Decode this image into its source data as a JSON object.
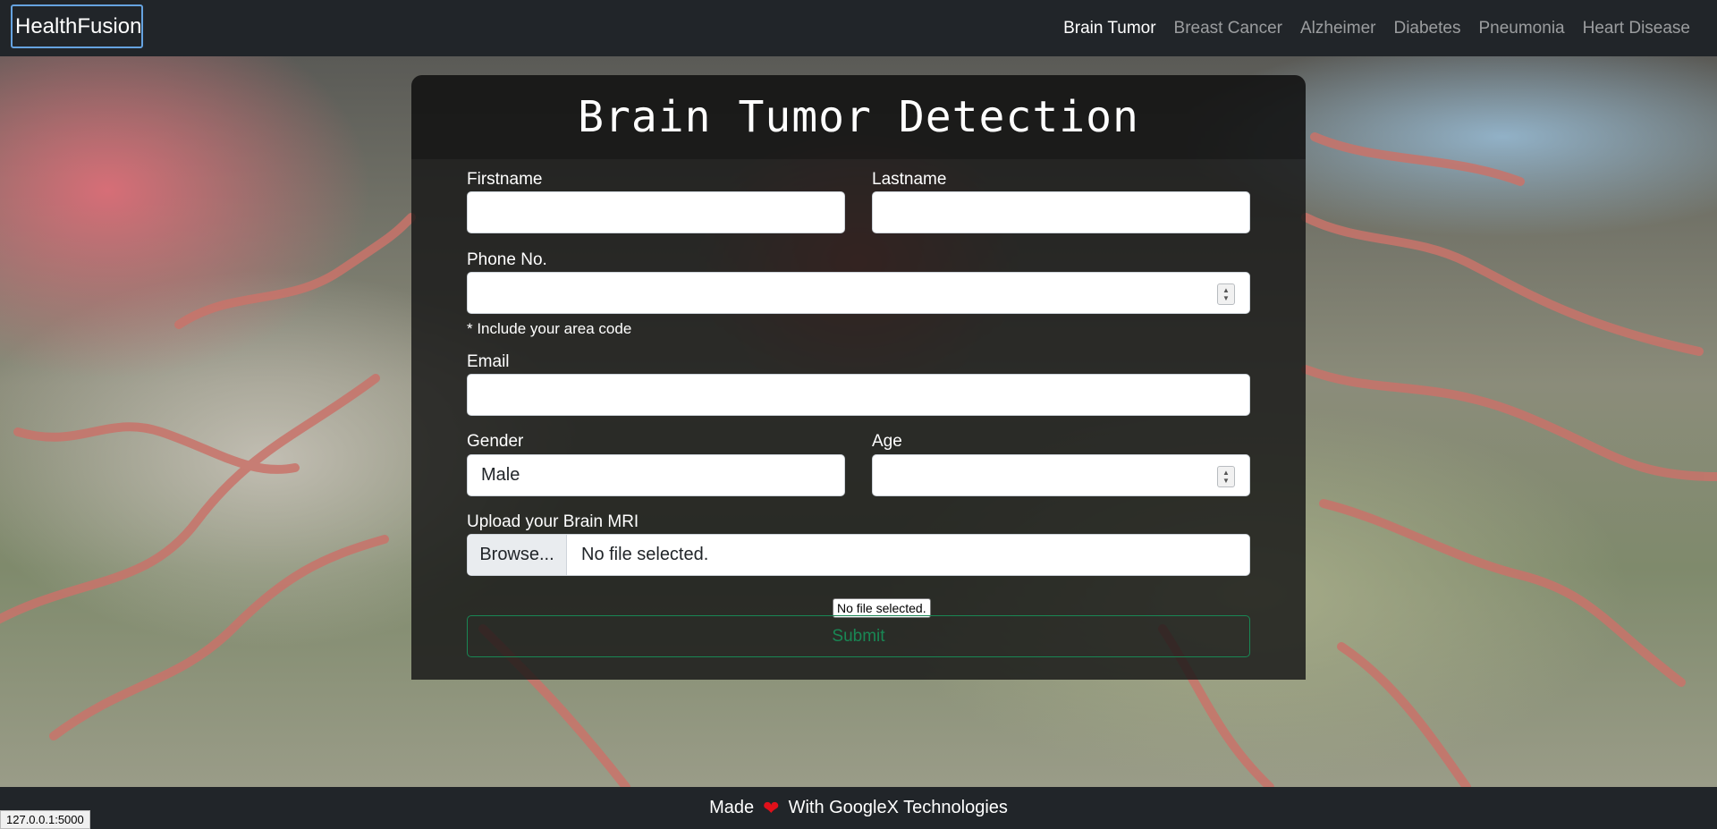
{
  "navbar": {
    "brand": "HealthFusion",
    "links": [
      {
        "label": "Brain Tumor",
        "active": true
      },
      {
        "label": "Breast Cancer",
        "active": false
      },
      {
        "label": "Alzheimer",
        "active": false
      },
      {
        "label": "Diabetes",
        "active": false
      },
      {
        "label": "Pneumonia",
        "active": false
      },
      {
        "label": "Heart Disease",
        "active": false
      }
    ]
  },
  "form": {
    "title": "Brain Tumor Detection",
    "firstname": {
      "label": "Firstname",
      "value": ""
    },
    "lastname": {
      "label": "Lastname",
      "value": ""
    },
    "phone": {
      "label": "Phone No.",
      "value": "",
      "help": "* Include your area code"
    },
    "email": {
      "label": "Email",
      "value": ""
    },
    "gender": {
      "label": "Gender",
      "value": "Male"
    },
    "age": {
      "label": "Age",
      "value": ""
    },
    "upload": {
      "label": "Upload your Brain MRI",
      "button": "Browse...",
      "status": "No file selected."
    },
    "tooltip": "No file selected.",
    "submit": "Submit"
  },
  "footer": {
    "made": "Made",
    "heart": "❤",
    "with": "With GoogleX Technologies"
  },
  "statusbar": "127.0.0.1:5000",
  "colors": {
    "navbar": "#212529",
    "accent_submit": "#198754",
    "heart": "#e0101a"
  }
}
